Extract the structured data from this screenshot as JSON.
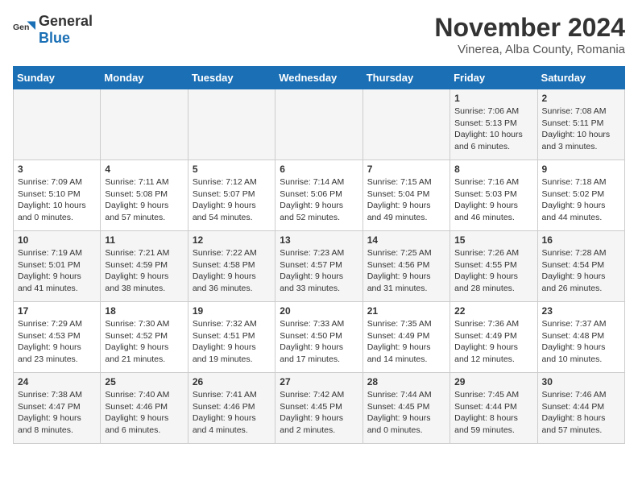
{
  "header": {
    "logo_general": "General",
    "logo_blue": "Blue",
    "month_title": "November 2024",
    "location": "Vinerea, Alba County, Romania"
  },
  "weekdays": [
    "Sunday",
    "Monday",
    "Tuesday",
    "Wednesday",
    "Thursday",
    "Friday",
    "Saturday"
  ],
  "weeks": [
    [
      null,
      null,
      null,
      null,
      null,
      {
        "day": "1",
        "sunrise": "7:06 AM",
        "sunset": "5:13 PM",
        "daylight": "10 hours and 6 minutes."
      },
      {
        "day": "2",
        "sunrise": "7:08 AM",
        "sunset": "5:11 PM",
        "daylight": "10 hours and 3 minutes."
      }
    ],
    [
      {
        "day": "3",
        "sunrise": "7:09 AM",
        "sunset": "5:10 PM",
        "daylight": "10 hours and 0 minutes."
      },
      {
        "day": "4",
        "sunrise": "7:11 AM",
        "sunset": "5:08 PM",
        "daylight": "9 hours and 57 minutes."
      },
      {
        "day": "5",
        "sunrise": "7:12 AM",
        "sunset": "5:07 PM",
        "daylight": "9 hours and 54 minutes."
      },
      {
        "day": "6",
        "sunrise": "7:14 AM",
        "sunset": "5:06 PM",
        "daylight": "9 hours and 52 minutes."
      },
      {
        "day": "7",
        "sunrise": "7:15 AM",
        "sunset": "5:04 PM",
        "daylight": "9 hours and 49 minutes."
      },
      {
        "day": "8",
        "sunrise": "7:16 AM",
        "sunset": "5:03 PM",
        "daylight": "9 hours and 46 minutes."
      },
      {
        "day": "9",
        "sunrise": "7:18 AM",
        "sunset": "5:02 PM",
        "daylight": "9 hours and 44 minutes."
      }
    ],
    [
      {
        "day": "10",
        "sunrise": "7:19 AM",
        "sunset": "5:01 PM",
        "daylight": "9 hours and 41 minutes."
      },
      {
        "day": "11",
        "sunrise": "7:21 AM",
        "sunset": "4:59 PM",
        "daylight": "9 hours and 38 minutes."
      },
      {
        "day": "12",
        "sunrise": "7:22 AM",
        "sunset": "4:58 PM",
        "daylight": "9 hours and 36 minutes."
      },
      {
        "day": "13",
        "sunrise": "7:23 AM",
        "sunset": "4:57 PM",
        "daylight": "9 hours and 33 minutes."
      },
      {
        "day": "14",
        "sunrise": "7:25 AM",
        "sunset": "4:56 PM",
        "daylight": "9 hours and 31 minutes."
      },
      {
        "day": "15",
        "sunrise": "7:26 AM",
        "sunset": "4:55 PM",
        "daylight": "9 hours and 28 minutes."
      },
      {
        "day": "16",
        "sunrise": "7:28 AM",
        "sunset": "4:54 PM",
        "daylight": "9 hours and 26 minutes."
      }
    ],
    [
      {
        "day": "17",
        "sunrise": "7:29 AM",
        "sunset": "4:53 PM",
        "daylight": "9 hours and 23 minutes."
      },
      {
        "day": "18",
        "sunrise": "7:30 AM",
        "sunset": "4:52 PM",
        "daylight": "9 hours and 21 minutes."
      },
      {
        "day": "19",
        "sunrise": "7:32 AM",
        "sunset": "4:51 PM",
        "daylight": "9 hours and 19 minutes."
      },
      {
        "day": "20",
        "sunrise": "7:33 AM",
        "sunset": "4:50 PM",
        "daylight": "9 hours and 17 minutes."
      },
      {
        "day": "21",
        "sunrise": "7:35 AM",
        "sunset": "4:49 PM",
        "daylight": "9 hours and 14 minutes."
      },
      {
        "day": "22",
        "sunrise": "7:36 AM",
        "sunset": "4:49 PM",
        "daylight": "9 hours and 12 minutes."
      },
      {
        "day": "23",
        "sunrise": "7:37 AM",
        "sunset": "4:48 PM",
        "daylight": "9 hours and 10 minutes."
      }
    ],
    [
      {
        "day": "24",
        "sunrise": "7:38 AM",
        "sunset": "4:47 PM",
        "daylight": "9 hours and 8 minutes."
      },
      {
        "day": "25",
        "sunrise": "7:40 AM",
        "sunset": "4:46 PM",
        "daylight": "9 hours and 6 minutes."
      },
      {
        "day": "26",
        "sunrise": "7:41 AM",
        "sunset": "4:46 PM",
        "daylight": "9 hours and 4 minutes."
      },
      {
        "day": "27",
        "sunrise": "7:42 AM",
        "sunset": "4:45 PM",
        "daylight": "9 hours and 2 minutes."
      },
      {
        "day": "28",
        "sunrise": "7:44 AM",
        "sunset": "4:45 PM",
        "daylight": "9 hours and 0 minutes."
      },
      {
        "day": "29",
        "sunrise": "7:45 AM",
        "sunset": "4:44 PM",
        "daylight": "8 hours and 59 minutes."
      },
      {
        "day": "30",
        "sunrise": "7:46 AM",
        "sunset": "4:44 PM",
        "daylight": "8 hours and 57 minutes."
      }
    ]
  ],
  "labels": {
    "sunrise": "Sunrise:",
    "sunset": "Sunset:",
    "daylight": "Daylight:"
  }
}
